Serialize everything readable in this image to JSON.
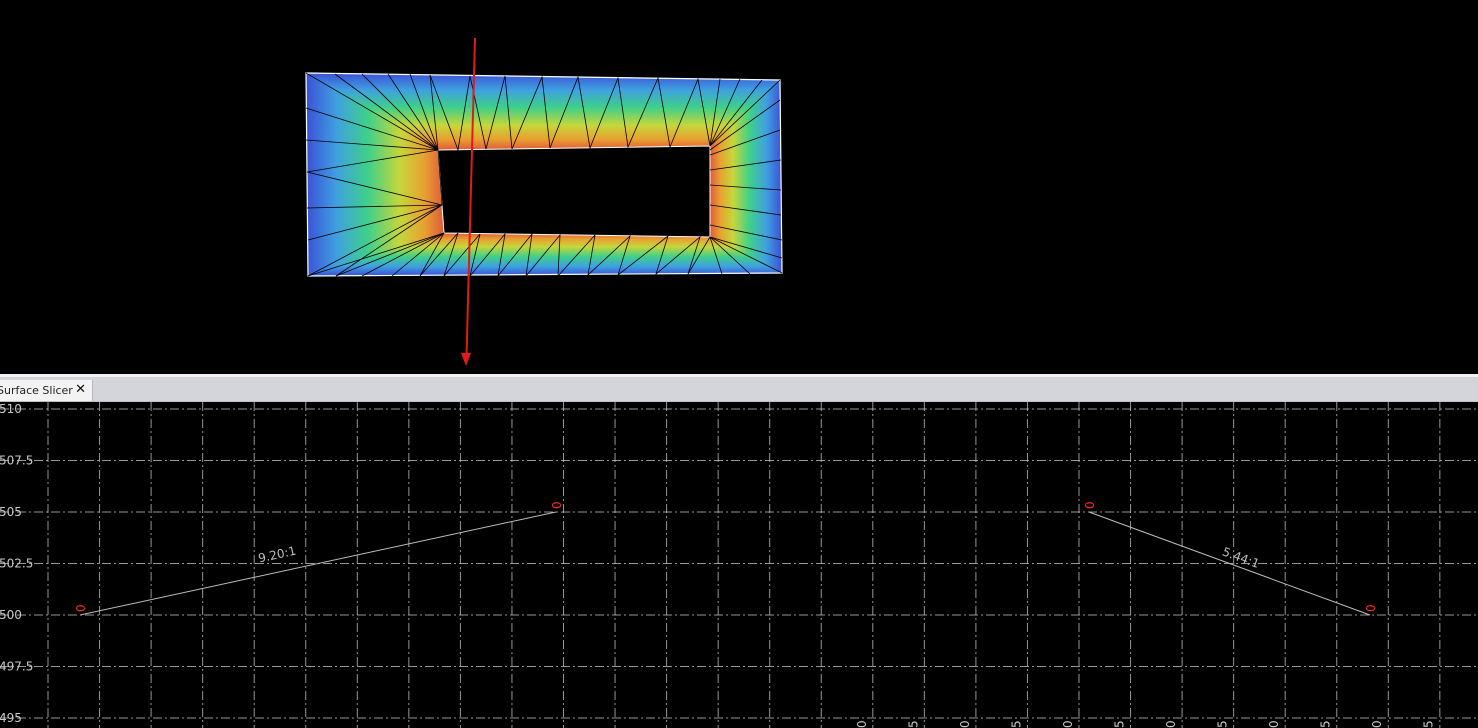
{
  "tabs": [
    {
      "label": "Surface Slicer",
      "close_glyph": "✕"
    }
  ],
  "profile": {
    "y_axis_labels": [
      "510",
      "507.5",
      "505",
      "502.5",
      "500",
      "497.5",
      "495"
    ],
    "y_range": [
      495,
      510
    ],
    "x_axis_labels": [
      "0",
      "5",
      "0",
      "5",
      "0",
      "5",
      "0",
      "5",
      "0",
      "5",
      "0",
      "5"
    ],
    "vertex_labels": [
      "0",
      "0",
      "0",
      "0"
    ],
    "slope_labels": [
      "9.20:1",
      "5.44:1"
    ],
    "points": [
      {
        "x": 80,
        "elev": 500
      },
      {
        "x": 556,
        "elev": 505
      },
      {
        "x": 1089,
        "elev": 505
      },
      {
        "x": 1370,
        "elev": 500
      }
    ]
  },
  "colors": {
    "background": "#000000",
    "grid": "#c8c8c8",
    "profile_line": "#bdbdbd",
    "vertex_label": "#ff2a2a",
    "slice_line": "#e31a1a",
    "tab_bar": "#d4d5da",
    "tab_active": "#f3f3f3"
  }
}
